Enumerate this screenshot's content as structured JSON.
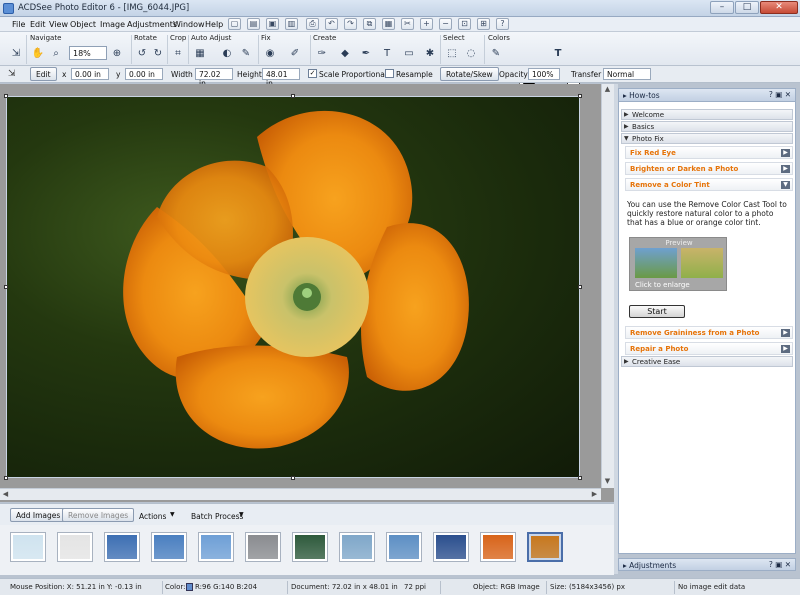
{
  "window": {
    "title": "ACDSee Photo Editor 6 - [IMG_6044.JPG]",
    "min": "–",
    "max": "□",
    "close": "✕"
  },
  "menu": [
    "File",
    "Edit",
    "View",
    "Object",
    "Image",
    "Adjustments",
    "Window",
    "Help"
  ],
  "toolbar": {
    "groups": [
      "Navigate",
      "Rotate",
      "Crop",
      "Auto Adjust",
      "Fix",
      "Create",
      "Select",
      "Colors"
    ],
    "zoom": "18%"
  },
  "options": {
    "edit": "Edit",
    "x_label": "x",
    "x_value": "0.00 in",
    "y_label": "y",
    "y_value": "0.00 in",
    "width_label": "Width",
    "width_value": "72.02 in",
    "height_label": "Height",
    "height_value": "48.01 in",
    "scale_prop": "Scale Proportional",
    "resample": "Resample",
    "rotate_skew": "Rotate/Skew",
    "opacity_label": "Opacity",
    "opacity_value": "100%",
    "transfer_label": "Transfer",
    "transfer_value": "Normal"
  },
  "howtos": {
    "title": "How-tos",
    "sections": [
      "Welcome",
      "Basics",
      "Photo Fix",
      "Creative Ease"
    ],
    "items": [
      "Fix Red Eye",
      "Brighten or Darken a Photo",
      "Remove a Color Tint",
      "Remove Graininess from a Photo",
      "Repair a Photo"
    ],
    "description": "You can use the Remove Color Cast Tool to quickly restore natural color to a photo that has a blue or orange color tint.",
    "preview_label": "Preview",
    "enlarge": "Click to enlarge",
    "start": "Start"
  },
  "adjustments": {
    "title": "Adjustments"
  },
  "filmstrip": {
    "add": "Add Images",
    "remove": "Remove Images",
    "actions": "Actions",
    "batch": "Batch Process",
    "thumb_colors": [
      "#cfe3ef",
      "#e4e4e4",
      "#3d6fb3",
      "#4a7fc0",
      "#6e9fd6",
      "#8a8c90",
      "#2e5a3c",
      "#7fa7c9",
      "#5d8fc4",
      "#2b4f8e",
      "#d8641a",
      "#c8781e"
    ]
  },
  "status": {
    "mouse": "Mouse Position:  X: 51.21 in    Y: -0.13 in",
    "color_label": "Color:",
    "rgb": "R:96  G:140  B:204",
    "document": "Document: 72.02 in x 48.01 in",
    "ppi": "72 ppi",
    "object": "Object: RGB Image",
    "size": "Size: (5184x3456) px",
    "edit": "No image edit data"
  }
}
